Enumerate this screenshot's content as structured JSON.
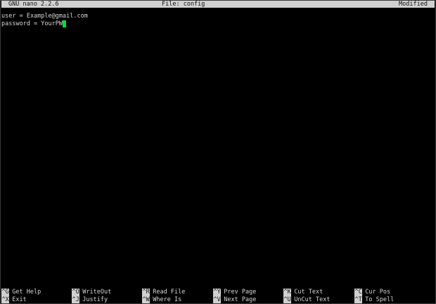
{
  "titlebar": {
    "app": "GNU nano 2.2.6",
    "file": "File: config",
    "status": "Modified"
  },
  "editor": {
    "lines": [
      "user = Example@gmail.com",
      "password = YourPW"
    ]
  },
  "shortcuts": {
    "row1": [
      {
        "key": "^G",
        "label": "Get Help"
      },
      {
        "key": "^O",
        "label": "WriteOut"
      },
      {
        "key": "^R",
        "label": "Read File"
      },
      {
        "key": "^Y",
        "label": "Prev Page"
      },
      {
        "key": "^K",
        "label": "Cut Text"
      },
      {
        "key": "^C",
        "label": "Cur Pos"
      }
    ],
    "row2": [
      {
        "key": "^X",
        "label": "Exit"
      },
      {
        "key": "^J",
        "label": "Justify"
      },
      {
        "key": "^W",
        "label": "Where Is"
      },
      {
        "key": "^V",
        "label": "Next Page"
      },
      {
        "key": "^U",
        "label": "UnCut Text"
      },
      {
        "key": "^T",
        "label": "To Spell"
      }
    ]
  },
  "colors": {
    "background": "#000000",
    "text": "#d6d6d6",
    "bar": "#d0d0d0",
    "cursor": "#00e03c"
  }
}
